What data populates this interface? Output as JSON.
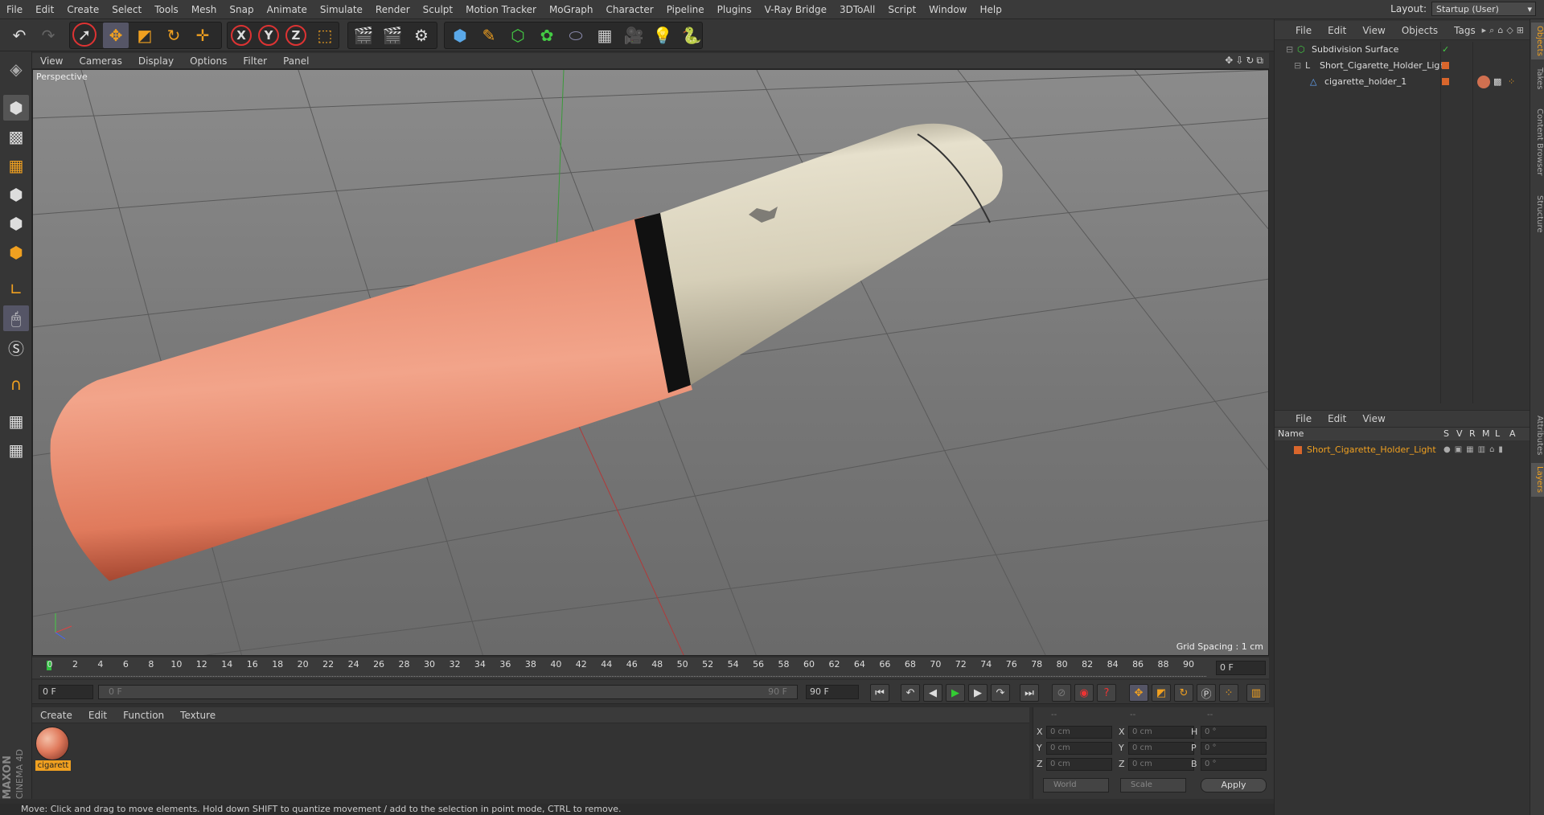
{
  "menubar": {
    "items": [
      "File",
      "Edit",
      "Create",
      "Select",
      "Tools",
      "Mesh",
      "Snap",
      "Animate",
      "Simulate",
      "Render",
      "Sculpt",
      "Motion Tracker",
      "MoGraph",
      "Character",
      "Pipeline",
      "Plugins",
      "V-Ray Bridge",
      "3DToAll",
      "Script",
      "Window",
      "Help"
    ],
    "layout_label": "Layout:",
    "layout_value": "Startup (User)"
  },
  "toolbar": {
    "axis_x": "X",
    "axis_y": "Y",
    "axis_z": "Z"
  },
  "viewport": {
    "menu": [
      "View",
      "Cameras",
      "Display",
      "Options",
      "Filter",
      "Panel"
    ],
    "camera_label": "Perspective",
    "grid_spacing": "Grid Spacing : 1 cm"
  },
  "timeline": {
    "ticks": [
      "0",
      "2",
      "4",
      "6",
      "8",
      "10",
      "12",
      "14",
      "16",
      "18",
      "20",
      "22",
      "24",
      "26",
      "28",
      "30",
      "32",
      "34",
      "36",
      "38",
      "40",
      "42",
      "44",
      "46",
      "48",
      "50",
      "52",
      "54",
      "56",
      "58",
      "60",
      "62",
      "64",
      "66",
      "68",
      "70",
      "72",
      "74",
      "76",
      "78",
      "80",
      "82",
      "84",
      "86",
      "88",
      "90"
    ],
    "current_frame": "0 F",
    "start_field": "0 F",
    "range_start": "0 F",
    "range_end": "90 F",
    "end_field": "90 F"
  },
  "material_manager": {
    "menu": [
      "Create",
      "Edit",
      "Function",
      "Texture"
    ],
    "material_name": "cigarett"
  },
  "coordinates": {
    "col1": [
      {
        "label": "X",
        "value": "0 cm"
      },
      {
        "label": "Y",
        "value": "0 cm"
      },
      {
        "label": "Z",
        "value": "0 cm"
      }
    ],
    "col2": [
      {
        "label": "X",
        "value": "0 cm"
      },
      {
        "label": "Y",
        "value": "0 cm"
      },
      {
        "label": "Z",
        "value": "0 cm"
      }
    ],
    "col3": [
      {
        "label": "H",
        "value": "0 °"
      },
      {
        "label": "P",
        "value": "0 °"
      },
      {
        "label": "B",
        "value": "0 °"
      }
    ],
    "header1": "--",
    "header2": "--",
    "header3": "--",
    "mode_world": "World",
    "mode_scale": "Scale",
    "apply_label": "Apply"
  },
  "status_bar": "Move: Click and drag to move elements. Hold down SHIFT to quantize movement / add to the selection in point mode, CTRL to remove.",
  "object_manager": {
    "menu": [
      "File",
      "Edit",
      "View",
      "Objects",
      "Tags"
    ],
    "objects": [
      {
        "name": "Subdivision Surface"
      },
      {
        "name": "Short_Cigarette_Holder_Light"
      },
      {
        "name": "cigarette_holder_1"
      }
    ]
  },
  "layer_manager": {
    "menu": [
      "File",
      "Edit",
      "View"
    ],
    "columns": {
      "name": "Name",
      "s": "S",
      "v": "V",
      "r": "R",
      "m": "M",
      "l": "L",
      "a": "A"
    },
    "layers": [
      {
        "name": "Short_Cigarette_Holder_Light",
        "color": "#d9662c"
      }
    ]
  },
  "side_tabs": [
    "Objects",
    "Takes",
    "Content Browser",
    "Structure",
    "Attributes",
    "Layers"
  ],
  "logo": {
    "brand1": "MAXON",
    "brand2": "CINEMA 4D"
  },
  "colors": {
    "accent": "#f0a020",
    "active_frame": "#30c040",
    "layer_orange": "#d9662c"
  }
}
